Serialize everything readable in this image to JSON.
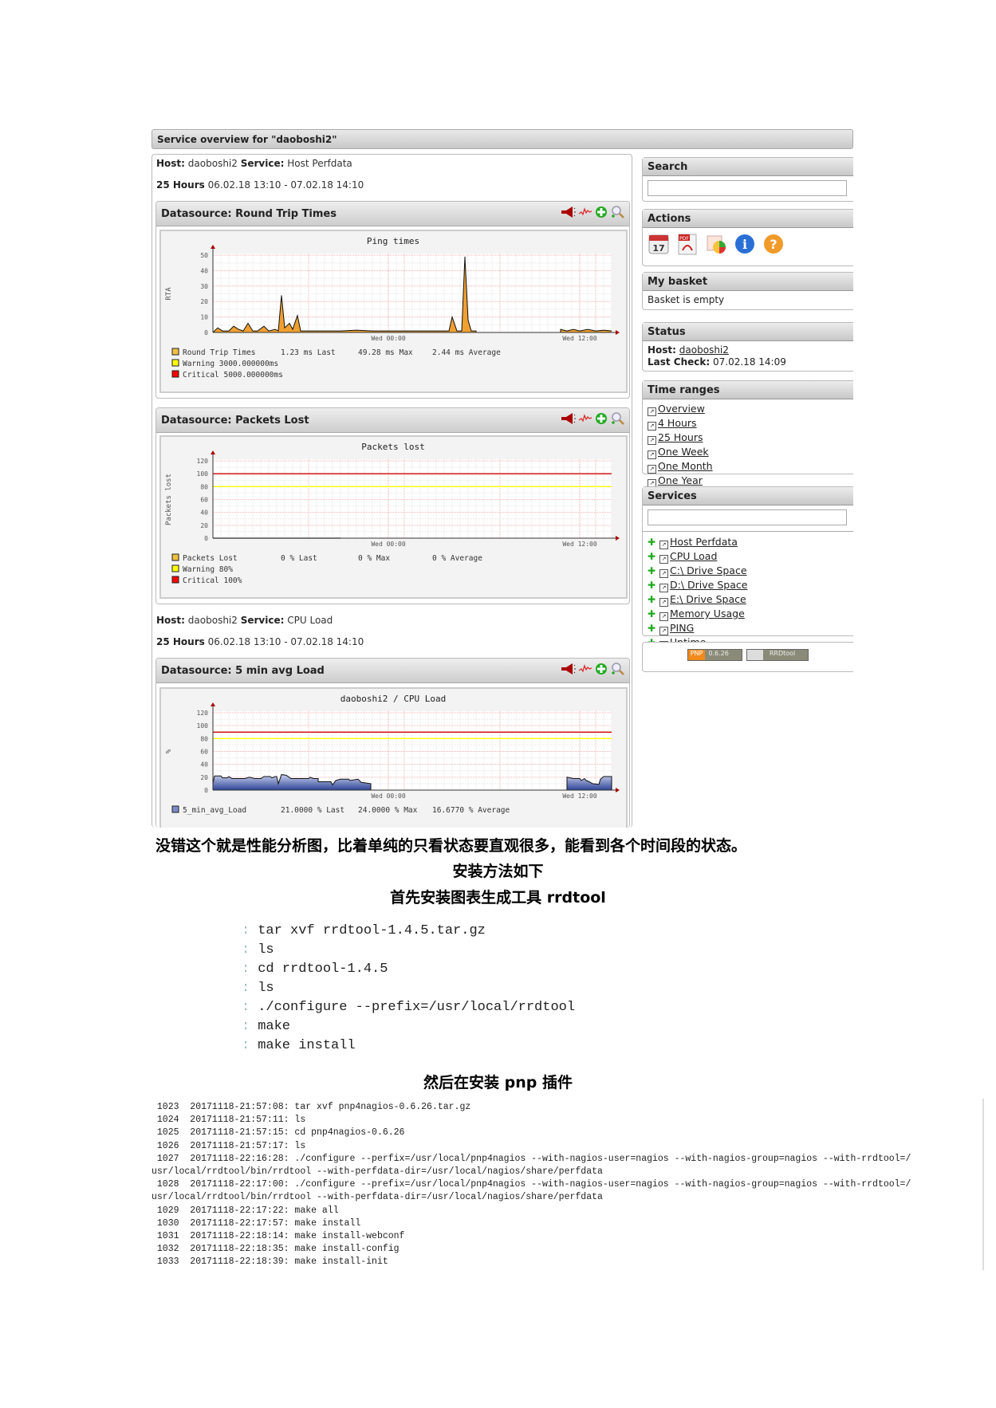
{
  "overview": {
    "title": "Service overview for \"daoboshi2\""
  },
  "blocks": [
    {
      "host_label": "Host:",
      "host": "daoboshi2",
      "service_label": "Service:",
      "service": "Host Perfdata",
      "range_label": "25 Hours",
      "range": "06.02.18 13:10 - 07.02.18 14:10"
    },
    {
      "host_label": "Host:",
      "host": "daoboshi2",
      "service_label": "Service:",
      "service": "CPU Load",
      "range_label": "25 Hours",
      "range": "06.02.18 13:10 - 07.02.18 14:10"
    }
  ],
  "datasources": [
    {
      "title": "Datasource: Round Trip Times"
    },
    {
      "title": "Datasource: Packets Lost"
    },
    {
      "title": "Datasource: 5 min avg Load"
    }
  ],
  "icons": [
    "speaker-icon",
    "graph-wave-icon",
    "add-basket-icon",
    "zoom-icon"
  ],
  "chart_data": [
    {
      "type": "area",
      "title": "Ping times",
      "ylabel": "RTA",
      "xlabel": "",
      "ylim": [
        0,
        50
      ],
      "yticks": [
        "0",
        "10",
        "20",
        "30",
        "40",
        "50"
      ],
      "xticks": [
        "Wed 00:00",
        "Wed 12:00"
      ],
      "xrange": [
        0,
        25
      ],
      "grid": true,
      "series": [
        {
          "name": "Round Trip Times",
          "color": "#f0a030",
          "points": [
            [
              0,
              0
            ],
            [
              0.3,
              3
            ],
            [
              0.6,
              1
            ],
            [
              1.0,
              1
            ],
            [
              1.3,
              4
            ],
            [
              1.6,
              2
            ],
            [
              1.9,
              1
            ],
            [
              2.2,
              6
            ],
            [
              2.5,
              1
            ],
            [
              2.8,
              1
            ],
            [
              3.2,
              4
            ],
            [
              3.5,
              1
            ],
            [
              3.9,
              2
            ],
            [
              4.1,
              1
            ],
            [
              4.3,
              24
            ],
            [
              4.5,
              3
            ],
            [
              4.8,
              6
            ],
            [
              5.0,
              2
            ],
            [
              5.3,
              11
            ],
            [
              5.5,
              1
            ],
            [
              6.0,
              1
            ],
            [
              7.0,
              1
            ],
            [
              8.0,
              1
            ],
            [
              9.0,
              1.5
            ],
            [
              10.0,
              1
            ],
            [
              11.0,
              1
            ],
            [
              13.0,
              1
            ],
            [
              14.8,
              1
            ],
            [
              15.0,
              10
            ],
            [
              15.3,
              1
            ],
            [
              15.6,
              1
            ],
            [
              15.8,
              49
            ],
            [
              16.0,
              8
            ],
            [
              16.2,
              1
            ],
            [
              16.5,
              1
            ],
            [
              16.5,
              0
            ],
            [
              21.8,
              0
            ],
            [
              21.8,
              2
            ],
            [
              22.2,
              1
            ],
            [
              22.6,
              2
            ],
            [
              23.0,
              1
            ],
            [
              23.5,
              2
            ],
            [
              24.0,
              1
            ],
            [
              24.5,
              1.5
            ],
            [
              25,
              1
            ]
          ]
        }
      ],
      "legend": [
        {
          "label": "Round Trip Times",
          "color": "#f0c040",
          "last": "1.23 ms Last",
          "max": "49.28 ms Max",
          "avg": "2.44 ms Average"
        },
        {
          "label": "Warning  3000.000000ms",
          "color": "#ffff00"
        },
        {
          "label": "Critical 5000.000000ms",
          "color": "#ff0000"
        }
      ]
    },
    {
      "type": "line",
      "title": "Packets lost",
      "ylabel": "Packets lost",
      "xlabel": "",
      "ylim": [
        0,
        120
      ],
      "yticks": [
        "0",
        "20",
        "40",
        "60",
        "80",
        "100",
        "120"
      ],
      "xticks": [
        "Wed 00:00",
        "Wed 12:00"
      ],
      "xrange": [
        0,
        25
      ],
      "grid": true,
      "series": [
        {
          "name": "Packets Lost",
          "color": "#000000",
          "points": [
            [
              0,
              0
            ],
            [
              8,
              0
            ]
          ]
        },
        {
          "name": "Warning",
          "color": "#ffff00",
          "points": [
            [
              0,
              80
            ],
            [
              25,
              80
            ]
          ]
        },
        {
          "name": "Critical",
          "color": "#cc0000",
          "points": [
            [
              0,
              100
            ],
            [
              25,
              100
            ]
          ]
        }
      ],
      "legend": [
        {
          "label": "Packets Lost",
          "color": "#f0c040",
          "last": "0 % Last",
          "max": "0 % Max",
          "avg": "0 % Average"
        },
        {
          "label": "Warning  80%",
          "color": "#ffff00"
        },
        {
          "label": "Critical 100%",
          "color": "#ff0000"
        }
      ]
    },
    {
      "type": "area",
      "title": "daoboshi2 / CPU Load",
      "ylabel": "%",
      "xlabel": "",
      "ylim": [
        0,
        120
      ],
      "yticks": [
        "0",
        "20",
        "40",
        "60",
        "80",
        "100",
        "120"
      ],
      "xticks": [
        "Wed 00:00",
        "Wed 12:00"
      ],
      "xrange": [
        0,
        25
      ],
      "grid": true,
      "series": [
        {
          "name": "5_min_avg_Load",
          "color": "#5a6fb0",
          "points": [
            [
              0,
              0
            ],
            [
              0,
              10
            ],
            [
              0.1,
              22
            ],
            [
              0.5,
              22
            ],
            [
              0.6,
              19
            ],
            [
              0.9,
              19
            ],
            [
              1.0,
              21
            ],
            [
              1.2,
              18
            ],
            [
              2.0,
              18
            ],
            [
              2.3,
              20
            ],
            [
              2.6,
              18
            ],
            [
              3.0,
              18
            ],
            [
              3.2,
              21
            ],
            [
              3.6,
              21
            ],
            [
              3.7,
              19
            ],
            [
              3.9,
              21
            ],
            [
              4.0,
              21
            ],
            [
              4.1,
              10
            ],
            [
              4.3,
              24
            ],
            [
              4.6,
              23
            ],
            [
              4.9,
              18
            ],
            [
              5.6,
              18
            ],
            [
              6.0,
              18
            ],
            [
              6.1,
              20
            ],
            [
              6.3,
              18
            ],
            [
              6.6,
              18
            ],
            [
              6.6,
              13
            ],
            [
              7.2,
              13
            ],
            [
              7.4,
              13
            ],
            [
              7.5,
              8
            ],
            [
              7.7,
              15
            ],
            [
              8.0,
              17
            ],
            [
              8.5,
              17
            ],
            [
              8.6,
              15
            ],
            [
              9.1,
              17
            ],
            [
              9.3,
              12
            ],
            [
              9.9,
              10
            ],
            [
              9.9,
              0
            ],
            [
              22.2,
              0
            ],
            [
              22.2,
              20
            ],
            [
              22.6,
              18
            ],
            [
              23.0,
              18
            ],
            [
              23.1,
              15
            ],
            [
              23.3,
              18
            ],
            [
              23.4,
              15
            ],
            [
              23.6,
              13
            ],
            [
              23.8,
              10
            ],
            [
              24.2,
              9
            ],
            [
              24.3,
              17
            ],
            [
              24.5,
              21
            ],
            [
              25,
              21
            ],
            [
              25,
              0
            ]
          ]
        },
        {
          "name": "Warning",
          "color": "#ffff00",
          "points": [
            [
              0,
              80
            ],
            [
              25,
              80
            ]
          ]
        },
        {
          "name": "Critical",
          "color": "#cc0000",
          "points": [
            [
              0,
              90
            ],
            [
              25,
              90
            ]
          ]
        }
      ],
      "legend": [
        {
          "label": "5_min_avg_Load",
          "color": "#7a8cc8",
          "last": "21.0000  % Last",
          "max": "24.0000  % Max",
          "avg": "16.6770  % Average"
        }
      ]
    }
  ],
  "sidebar": {
    "search": {
      "title": "Search",
      "value": ""
    },
    "actions": {
      "title": "Actions",
      "items": [
        "calendar-icon",
        "pdf-icon",
        "chart-icon",
        "info-icon",
        "help-icon"
      ]
    },
    "basket": {
      "title": "My basket",
      "text": "Basket is empty"
    },
    "status": {
      "title": "Status",
      "host_label": "Host:",
      "host": "daoboshi2",
      "check_label": "Last Check:",
      "check": "07.02.18 14:09"
    },
    "time_ranges": {
      "title": "Time ranges",
      "items": [
        "Overview",
        "4 Hours",
        "25 Hours",
        "One Week",
        "One Month",
        "One Year"
      ]
    },
    "services": {
      "title": "Services",
      "filter": "",
      "items": [
        "Host Perfdata",
        "CPU Load",
        "C:\\ Drive Space",
        "D:\\ Drive Space",
        "E:\\ Drive Space",
        "Memory Usage",
        "PING",
        "Uptime"
      ]
    },
    "badges": {
      "pnp": "PNP",
      "pnp_version": "0.6.26",
      "rrd": "RRDtool"
    }
  },
  "text": {
    "para1": "没错这个就是性能分析图，比着单纯的只看状态要直观很多，能看到各个时间段的状态。",
    "para2": "安装方法如下",
    "para3": "首先安装图表生成工具 rrdtool",
    "para4": "然后在安装 pnp 插件"
  },
  "rrd_commands": [
    "tar xvf rrdtool-1.4.5.tar.gz",
    "ls",
    "cd rrdtool-1.4.5",
    "ls",
    "./configure --prefix=/usr/local/rrdtool",
    "make",
    "make install"
  ],
  "history": [
    " 1023  20171118-21:57:08: tar xvf pnp4nagios-0.6.26.tar.gz",
    " 1024  20171118-21:57:11: ls",
    " 1025  20171118-21:57:15: cd pnp4nagios-0.6.26",
    " 1026  20171118-21:57:17: ls",
    " 1027  20171118-22:16:28: ./configure --perfix=/usr/local/pnp4nagios --with-nagios-user=nagios --with-nagios-group=nagios --with-rrdtool=/",
    "usr/local/rrdtool/bin/rrdtool --with-perfdata-dir=/usr/local/nagios/share/perfdata",
    " 1028  20171118-22:17:00: ./configure --prefix=/usr/local/pnp4nagios --with-nagios-user=nagios --with-nagios-group=nagios --with-rrdtool=/",
    "usr/local/rrdtool/bin/rrdtool --with-perfdata-dir=/usr/local/nagios/share/perfdata",
    " 1029  20171118-22:17:22: make all",
    " 1030  20171118-22:17:57: make install",
    " 1031  20171118-22:18:14: make install-webconf",
    " 1032  20171118-22:18:35: make install-config",
    " 1033  20171118-22:18:39: make install-init"
  ]
}
